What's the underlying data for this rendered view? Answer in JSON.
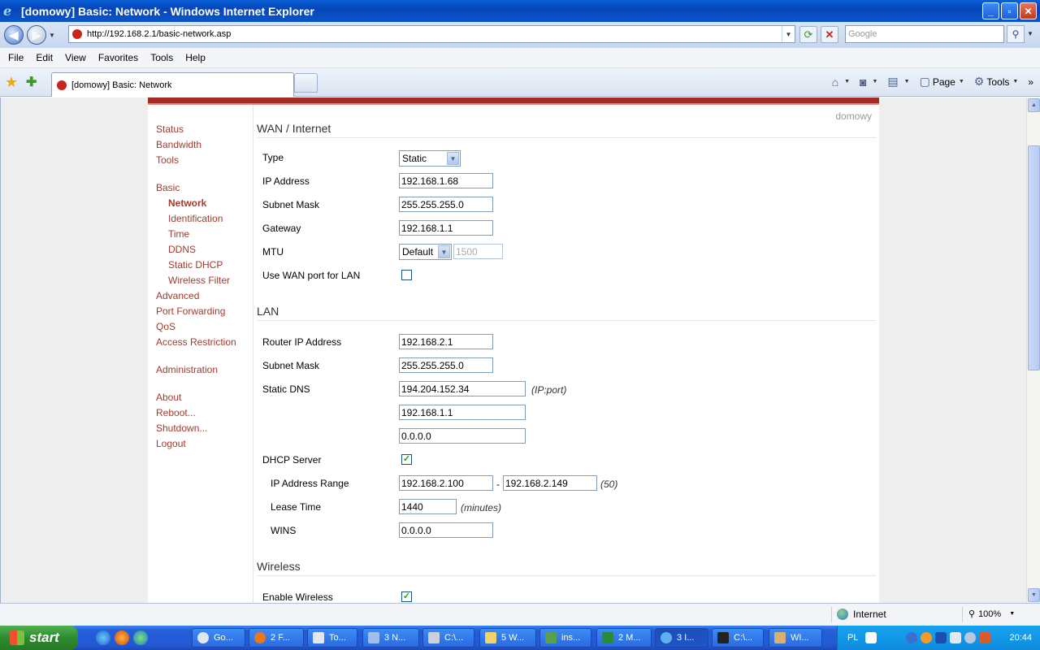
{
  "window": {
    "title": "[domowy] Basic: Network - Windows Internet Explorer",
    "minimize": "_",
    "maximize": "▫",
    "close": "✕"
  },
  "address": {
    "url": "http://192.168.2.1/basic-network.asp",
    "search_placeholder": "Google"
  },
  "menu": [
    "File",
    "Edit",
    "View",
    "Favorites",
    "Tools",
    "Help"
  ],
  "tab": {
    "label": "[domowy] Basic: Network"
  },
  "command_bar": {
    "page": "Page",
    "tools": "Tools"
  },
  "router_name": "domowy",
  "sidebar": {
    "status": "Status",
    "bandwidth": "Bandwidth",
    "tools": "Tools",
    "basic": "Basic",
    "network": "Network",
    "identification": "Identification",
    "time": "Time",
    "ddns": "DDNS",
    "static_dhcp": "Static DHCP",
    "wireless_filter": "Wireless Filter",
    "advanced": "Advanced",
    "port_forwarding": "Port Forwarding",
    "qos": "QoS",
    "access_restriction": "Access Restriction",
    "administration": "Administration",
    "about": "About",
    "reboot": "Reboot...",
    "shutdown": "Shutdown...",
    "logout": "Logout"
  },
  "wan": {
    "title": "WAN / Internet",
    "type_label": "Type",
    "type_value": "Static",
    "ip_label": "IP Address",
    "ip_value": "192.168.1.68",
    "mask_label": "Subnet Mask",
    "mask_value": "255.255.255.0",
    "gateway_label": "Gateway",
    "gateway_value": "192.168.1.1",
    "mtu_label": "MTU",
    "mtu_mode": "Default",
    "mtu_value": "1500",
    "wanport_label": "Use WAN port for LAN",
    "wanport_checked": false
  },
  "lan": {
    "title": "LAN",
    "router_ip_label": "Router IP Address",
    "router_ip_value": "192.168.2.1",
    "mask_label": "Subnet Mask",
    "mask_value": "255.255.255.0",
    "dns_label": "Static DNS",
    "dns1": "194.204.152.34",
    "dns_hint": "(IP:port)",
    "dns2": "192.168.1.1",
    "dns3": "0.0.0.0",
    "dhcp_label": "DHCP Server",
    "dhcp_check": "✓",
    "range_label": "IP Address Range",
    "range_start": "192.168.2.100",
    "range_dash": "-",
    "range_end": "192.168.2.149",
    "range_count": "(50)",
    "lease_label": "Lease Time",
    "lease_value": "1440",
    "lease_unit": "(minutes)",
    "wins_label": "WINS",
    "wins_value": "0.0.0.0"
  },
  "wireless": {
    "title": "Wireless",
    "enable_label": "Enable Wireless",
    "enable_check": "✓"
  },
  "status": {
    "zone": "Internet",
    "zoom": "100%"
  },
  "taskbar": {
    "start": "start",
    "items": [
      "Go...",
      "2 F...",
      "To...",
      "3 N...",
      "C:\\...",
      "5 W...",
      "ins...",
      "2 M...",
      "3 I...",
      "C:\\...",
      "WI..."
    ],
    "lang": "PL",
    "clock": "20:44"
  },
  "colors": {
    "accent_red": "#a32c27",
    "link": "#a33a2e",
    "xp_blue": "#245edb"
  }
}
